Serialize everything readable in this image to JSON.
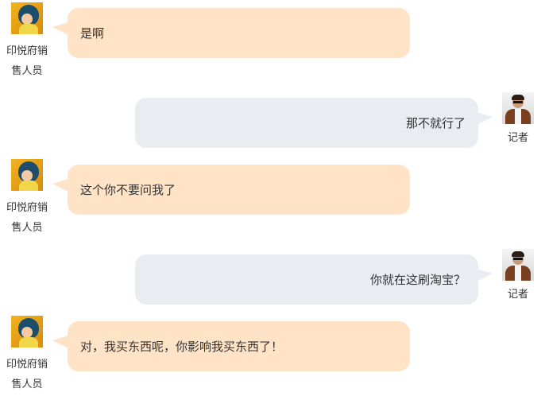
{
  "participants": {
    "sales": {
      "name_line1": "印悦府销",
      "name_line2": "售人员"
    },
    "reporter": {
      "name": "记者"
    }
  },
  "messages": [
    {
      "speaker": "sales",
      "text": "是啊"
    },
    {
      "speaker": "reporter",
      "text": "那不就行了"
    },
    {
      "speaker": "sales",
      "text": "这个你不要问我了"
    },
    {
      "speaker": "reporter",
      "text": "你就在这刷淘宝？"
    },
    {
      "speaker": "sales",
      "text": "对，我买东西呢，你影响我买东西了！"
    }
  ],
  "colors": {
    "sales_bubble": "#ffe3c6",
    "reporter_bubble": "#e9edf1",
    "text": "#333333"
  }
}
